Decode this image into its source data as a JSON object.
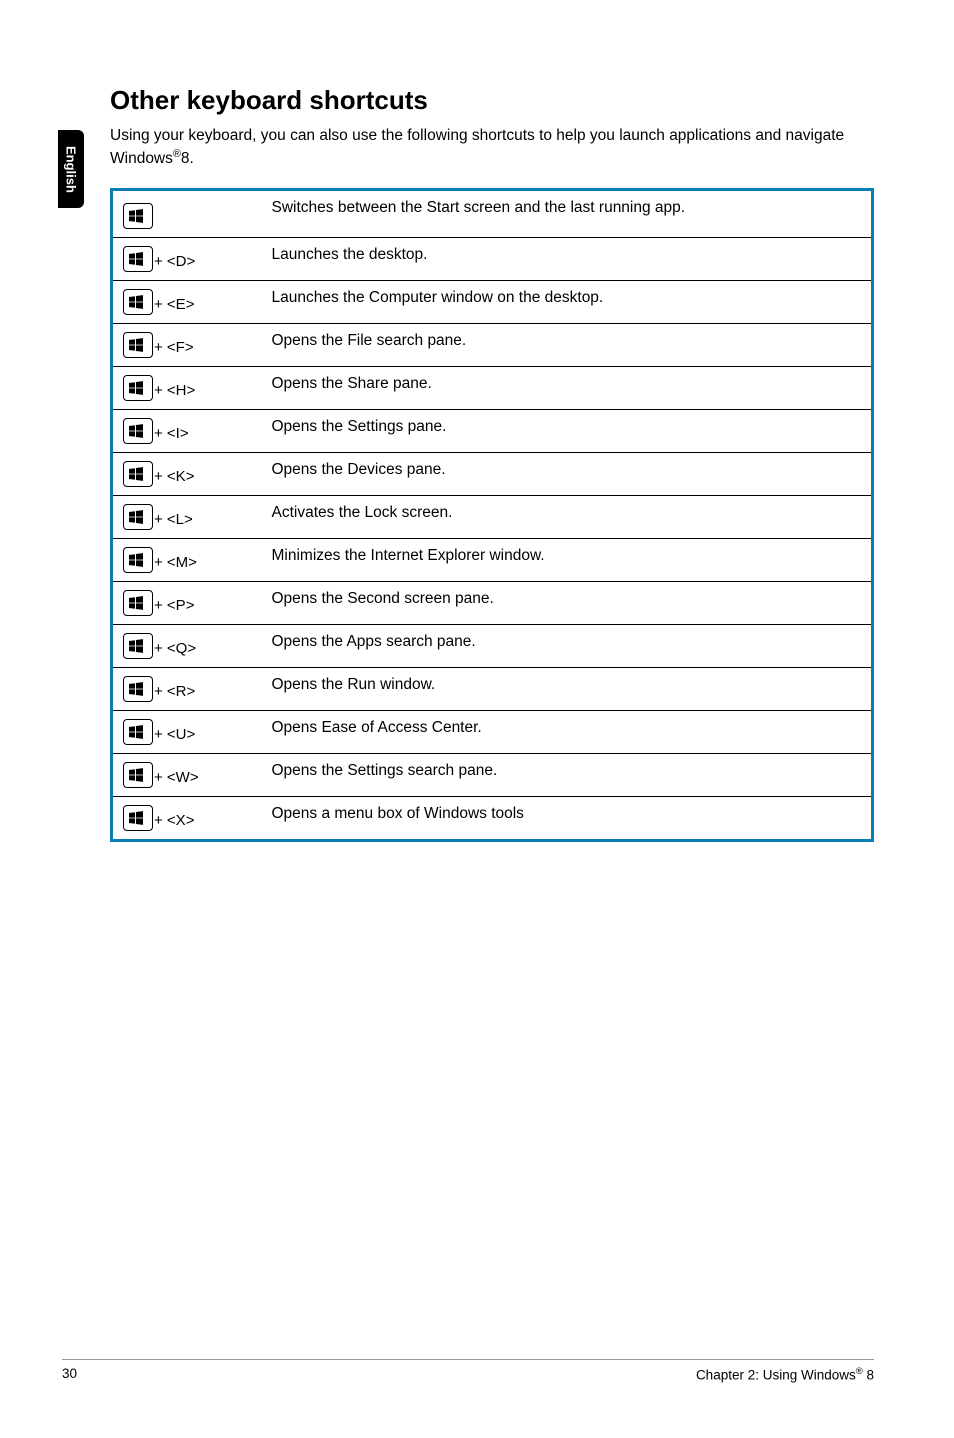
{
  "side_tab": "English",
  "heading": "Other keyboard shortcuts",
  "intro_prefix": "Using your keyboard, you can also use the following shortcuts to help you launch applications and navigate Windows",
  "intro_suffix": "8.",
  "rows": [
    {
      "key_suffix": "",
      "desc": "Switches between the Start screen and the last running app."
    },
    {
      "key_suffix": " + <D>",
      "desc": "Launches the desktop."
    },
    {
      "key_suffix": " + <E>",
      "desc": "Launches the Computer window on the desktop."
    },
    {
      "key_suffix": " + <F>",
      "desc": "Opens the File search pane."
    },
    {
      "key_suffix": " + <H>",
      "desc": "Opens the Share pane."
    },
    {
      "key_suffix": " + <I>",
      "desc": "Opens the Settings pane."
    },
    {
      "key_suffix": " + <K>",
      "desc": "Opens the Devices pane."
    },
    {
      "key_suffix": " + <L>",
      "desc": "Activates the Lock screen."
    },
    {
      "key_suffix": " + <M>",
      "desc": "Minimizes the Internet Explorer window."
    },
    {
      "key_suffix": " + <P>",
      "desc": "Opens the Second screen pane."
    },
    {
      "key_suffix": " + <Q>",
      "desc": "Opens the Apps search pane."
    },
    {
      "key_suffix": " + <R>",
      "desc": "Opens the Run window."
    },
    {
      "key_suffix": " + <U>",
      "desc": "Opens Ease of Access Center."
    },
    {
      "key_suffix": " + <W>",
      "desc": "Opens the Settings search pane."
    },
    {
      "key_suffix": " + <X>",
      "desc": "Opens a menu box of Windows tools"
    }
  ],
  "footer": {
    "page_number": "30",
    "chapter_prefix": "Chapter 2: Using Windows",
    "chapter_suffix": " 8"
  }
}
